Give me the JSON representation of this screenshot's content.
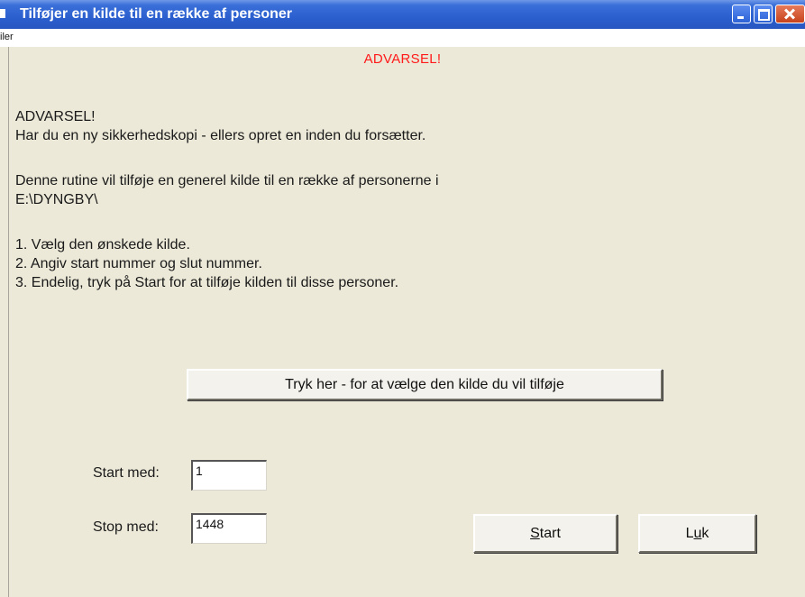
{
  "window": {
    "title": "Tilføjer en kilde til en række af personer"
  },
  "menu": {
    "items": [
      "iler"
    ]
  },
  "content": {
    "warning_heading": "ADVARSEL!",
    "lines": [
      "ADVARSEL!",
      "Har du en ny sikkerhedskopi - ellers opret en inden du forsætter.",
      "Denne rutine vil tilføje en generel kilde til en række af personerne i",
      "E:\\DYNGBY\\",
      "1. Vælg den ønskede kilde.",
      "2. Angiv start nummer og slut nummer.",
      "3. Endelig, tryk på Start for at tilføje kilden til disse personer."
    ]
  },
  "choose_source_button": {
    "label": "Tryk her - for at vælge den kilde du vil tilføje"
  },
  "start_field": {
    "label": "Start med:",
    "value": "1"
  },
  "stop_field": {
    "label": "Stop med:",
    "value": "1448"
  },
  "buttons": {
    "start": {
      "mnemonic": "S",
      "rest": "tart"
    },
    "close": {
      "prefix": "L",
      "mnemonic": "u",
      "rest": "k"
    }
  },
  "colors": {
    "title_bar": "#2b5fcf",
    "warning": "#ff1a1a",
    "background": "#ece9d8"
  }
}
